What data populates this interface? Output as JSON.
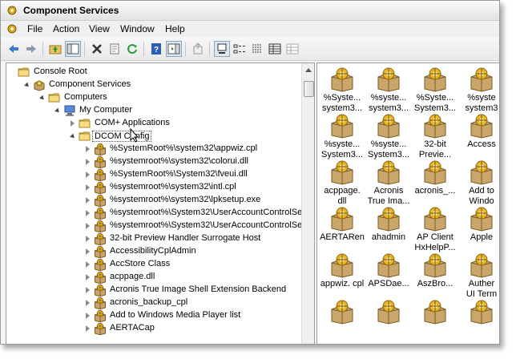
{
  "window": {
    "title": "Component Services"
  },
  "menu": [
    "File",
    "Action",
    "View",
    "Window",
    "Help"
  ],
  "toolbar": [
    "back-icon",
    "forward-icon",
    "up-icon",
    "show-hide-tree-icon",
    "delete-icon",
    "properties-icon",
    "refresh-icon",
    "help-icon",
    "show-hide-action-pane-icon",
    "export-list-icon",
    "large-icons-view-icon",
    "small-icons-view-icon",
    "list-view-icon",
    "details-view-icon",
    "status-view-icon"
  ],
  "tree": [
    {
      "label": "Console Root",
      "depth": 0,
      "icon": "folder-icon",
      "expander": "none"
    },
    {
      "label": "Component Services",
      "depth": 1,
      "icon": "component-services-icon",
      "expander": "open"
    },
    {
      "label": "Computers",
      "depth": 2,
      "icon": "folder-icon",
      "expander": "open"
    },
    {
      "label": "My Computer",
      "depth": 3,
      "icon": "computer-icon",
      "expander": "open"
    },
    {
      "label": "COM+ Applications",
      "depth": 4,
      "icon": "folder-icon",
      "expander": "closed"
    },
    {
      "label": "DCOM Config",
      "depth": 4,
      "icon": "folder-icon",
      "expander": "open",
      "selected": true
    },
    {
      "label": "%SystemRoot%\\system32\\appwiz.cpl",
      "depth": 5,
      "icon": "component-icon",
      "expander": "closed"
    },
    {
      "label": "%systemroot%\\system32\\colorui.dll",
      "depth": 5,
      "icon": "component-icon",
      "expander": "closed"
    },
    {
      "label": "%SystemRoot%\\System32\\fveui.dll",
      "depth": 5,
      "icon": "component-icon",
      "expander": "closed"
    },
    {
      "label": "%systemroot%\\system32\\intl.cpl",
      "depth": 5,
      "icon": "component-icon",
      "expander": "closed"
    },
    {
      "label": "%systemroot%\\system32\\lpksetup.exe",
      "depth": 5,
      "icon": "component-icon",
      "expander": "closed"
    },
    {
      "label": "%systemroot%\\System32\\UserAccountControlSett",
      "depth": 5,
      "icon": "component-icon",
      "expander": "closed"
    },
    {
      "label": "%systemroot%\\System32\\UserAccountControlSett",
      "depth": 5,
      "icon": "component-icon",
      "expander": "closed"
    },
    {
      "label": "32-bit Preview Handler Surrogate Host",
      "depth": 5,
      "icon": "component-icon",
      "expander": "closed"
    },
    {
      "label": "AccessibilityCplAdmin",
      "depth": 5,
      "icon": "component-icon",
      "expander": "closed"
    },
    {
      "label": "AccStore Class",
      "depth": 5,
      "icon": "component-icon",
      "expander": "closed"
    },
    {
      "label": "acppage.dll",
      "depth": 5,
      "icon": "component-icon",
      "expander": "closed"
    },
    {
      "label": "Acronis True Image Shell Extension Backend",
      "depth": 5,
      "icon": "component-icon",
      "expander": "closed"
    },
    {
      "label": "acronis_backup_cpl",
      "depth": 5,
      "icon": "component-icon",
      "expander": "closed"
    },
    {
      "label": "Add to Windows Media Player list",
      "depth": 5,
      "icon": "component-icon",
      "expander": "closed"
    },
    {
      "label": "AERTACap",
      "depth": 5,
      "icon": "component-icon",
      "expander": "closed"
    }
  ],
  "list_items": [
    [
      "%Syste...",
      "system3..."
    ],
    [
      "%syste...",
      "system3..."
    ],
    [
      "%Syste...",
      "System3..."
    ],
    [
      "%syste",
      "system3"
    ],
    [
      "%syste...",
      "System3..."
    ],
    [
      "%syste...",
      "System3..."
    ],
    [
      "32-bit",
      "Previe..."
    ],
    [
      "Access",
      ""
    ],
    [
      "acppage.",
      "dll"
    ],
    [
      "Acronis",
      "True Ima..."
    ],
    [
      "acronis_...",
      ""
    ],
    [
      "Add to",
      "Windo"
    ],
    [
      "AERTARen",
      ""
    ],
    [
      "ahadmin",
      ""
    ],
    [
      "AP Client",
      "HxHelpP..."
    ],
    [
      "Apple",
      ""
    ],
    [
      "appwiz. cpl",
      ""
    ],
    [
      "APSDae...",
      ""
    ],
    [
      "AszBro...",
      ""
    ],
    [
      "Auther",
      "UI Term"
    ],
    [
      "",
      ""
    ],
    [
      "",
      ""
    ],
    [
      "",
      ""
    ],
    [
      "",
      ""
    ]
  ]
}
